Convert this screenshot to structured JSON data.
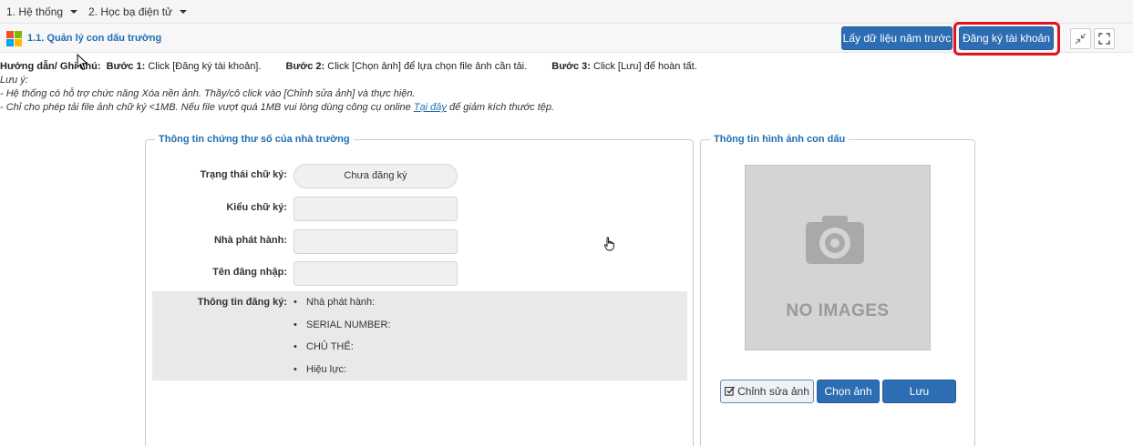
{
  "menu": {
    "items": [
      {
        "label": "1. Hệ thống"
      },
      {
        "label": "2. Học bạ điện tử"
      }
    ]
  },
  "header": {
    "title": "1.1. Quản lý con dấu trường",
    "btn_get_data": "Lấy dữ liệu năm trước",
    "btn_register": "Đăng ký tài khoản"
  },
  "guide": {
    "label": "Hướng dẫn/ Ghi chú:",
    "step1_label": "Bước 1:",
    "step1_text": "Click [Đăng ký tài khoản].",
    "step2_label": "Bước 2:",
    "step2_text": "Click [Chọn ảnh] để lựa chọn file ảnh cần tải.",
    "step3_label": "Bước 3:",
    "step3_text": "Click [Lưu] để hoàn tất.",
    "note_title": "Lưu ý:",
    "note1": "- Hệ thống có hỗ trợ chức năng Xóa nền ảnh. Thầy/cô click vào [Chỉnh sửa ảnh] và thực hiện.",
    "note2_before": "- Chỉ cho phép tải file ảnh chữ ký <1MB. Nếu file vượt quá 1MB vui lòng dùng công cụ online ",
    "note2_link": "Tại đây",
    "note2_after": " để giảm kích thước tệp."
  },
  "cert_panel": {
    "legend": "Thông tin chứng thư số của nhà trường",
    "status_label": "Trạng thái chữ ký:",
    "status_value": "Chưa đăng ký",
    "type_label": "Kiểu chữ ký:",
    "type_value": "",
    "issuer_label": "Nhà phát hành:",
    "issuer_value": "",
    "login_label": "Tên đăng nhập:",
    "login_value": "",
    "reg_label": "Thông tin đăng ký:",
    "reg_items": [
      "Nhà phát hành:",
      "SERIAL NUMBER:",
      "CHỦ THỂ:",
      "Hiệu lực:"
    ]
  },
  "image_panel": {
    "legend": "Thông tin hình ảnh con dấu",
    "placeholder": "NO IMAGES",
    "btn_edit": "Chỉnh sửa ảnh",
    "btn_choose": "Chọn ảnh",
    "btn_save": "Lưu"
  },
  "colors": {
    "accent": "#2d6db3",
    "title": "#1f6fb5",
    "highlight": "#e0141e"
  }
}
